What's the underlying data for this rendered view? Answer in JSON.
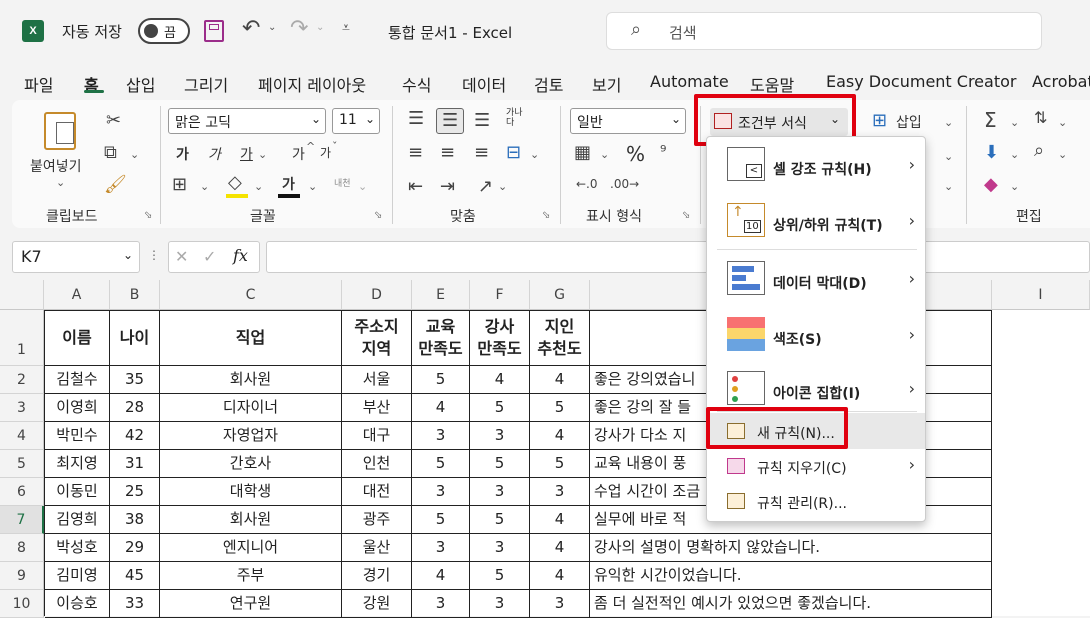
{
  "app": {
    "logo": "X",
    "autosave_label": "자동 저장",
    "autosave_state": "끔",
    "doc_title": "통합 문서1  -  Excel",
    "search_placeholder": "검색"
  },
  "tabs": [
    "파일",
    "홈",
    "삽입",
    "그리기",
    "페이지 레이아웃",
    "수식",
    "데이터",
    "검토",
    "보기",
    "Automate",
    "도움말",
    "Easy Document Creator",
    "Acrobat"
  ],
  "ribbon": {
    "clipboard": {
      "paste": "붙여넣기",
      "label": "클립보드"
    },
    "font": {
      "name": "맑은 고딕",
      "size": "11",
      "bold": "가",
      "italic": "가",
      "underline": "가",
      "grow": "가",
      "shrink": "가",
      "color_letter": "가",
      "phonetic": "내천",
      "label": "글꼴"
    },
    "align": {
      "wrap": "가나다",
      "label": "맞춤"
    },
    "number": {
      "format": "일반",
      "percent": "%",
      "label": "표시 형식"
    },
    "styles": {
      "conditional": "조건부 서식"
    },
    "cells": {
      "insert": "삽입"
    },
    "edit": {
      "label": "편집"
    }
  },
  "formula_bar": {
    "name_box": "K7",
    "fx": "fx",
    "cancel": "✕",
    "enter": "✓"
  },
  "grid": {
    "columns": [
      "A",
      "B",
      "C",
      "D",
      "E",
      "F",
      "G",
      "",
      "I"
    ],
    "header_row": {
      "A": "이름",
      "B": "나이",
      "C": "직업",
      "D1": "주소지",
      "D2": "지역",
      "E1": "교육",
      "E2": "만족도",
      "F1": "강사",
      "F2": "만족도",
      "G1": "지인",
      "G2": "추천도"
    },
    "rows": [
      {
        "n": "1"
      },
      {
        "n": "2",
        "a": "김철수",
        "b": "35",
        "c": "회사원",
        "d": "서울",
        "e": "5",
        "f": "4",
        "g": "4",
        "h": "좋은 강의였습니"
      },
      {
        "n": "3",
        "a": "이영희",
        "b": "28",
        "c": "디자이너",
        "d": "부산",
        "e": "4",
        "f": "5",
        "g": "5",
        "h": "좋은 강의 잘 들"
      },
      {
        "n": "4",
        "a": "박민수",
        "b": "42",
        "c": "자영업자",
        "d": "대구",
        "e": "3",
        "f": "3",
        "g": "4",
        "h": "강사가 다소 지"
      },
      {
        "n": "5",
        "a": "최지영",
        "b": "31",
        "c": "간호사",
        "d": "인천",
        "e": "5",
        "f": "5",
        "g": "5",
        "h": "교육 내용이 풍"
      },
      {
        "n": "6",
        "a": "이동민",
        "b": "25",
        "c": "대학생",
        "d": "대전",
        "e": "3",
        "f": "3",
        "g": "3",
        "h": "수업 시간이 조금"
      },
      {
        "n": "7",
        "a": "김영희",
        "b": "38",
        "c": "회사원",
        "d": "광주",
        "e": "5",
        "f": "5",
        "g": "4",
        "h": "실무에 바로 적"
      },
      {
        "n": "8",
        "a": "박성호",
        "b": "29",
        "c": "엔지니어",
        "d": "울산",
        "e": "3",
        "f": "3",
        "g": "4",
        "h": "강사의 설명이 명확하지 않았습니다."
      },
      {
        "n": "9",
        "a": "김미영",
        "b": "45",
        "c": "주부",
        "d": "경기",
        "e": "4",
        "f": "5",
        "g": "4",
        "h": "유익한 시간이었습니다."
      },
      {
        "n": "10",
        "a": "이승호",
        "b": "33",
        "c": "연구원",
        "d": "강원",
        "e": "3",
        "f": "3",
        "g": "3",
        "h": "좀 더 실전적인 예시가 있었으면 좋겠습니다."
      }
    ]
  },
  "menu": {
    "items": [
      {
        "label": "셀 강조 규칙(H)"
      },
      {
        "label": "상위/하위 규칙(T)",
        "icon_text": "10"
      },
      {
        "label": "데이터 막대(D)"
      },
      {
        "label": "색조(S)"
      },
      {
        "label": "아이콘 집합(I)"
      },
      {
        "label": "새 규칙(N)..."
      },
      {
        "label": "규칙 지우기(C)"
      },
      {
        "label": "규칙 관리(R)..."
      }
    ]
  },
  "colors": {
    "excel_green": "#1e7145",
    "highlight_red": "#e0000f"
  }
}
